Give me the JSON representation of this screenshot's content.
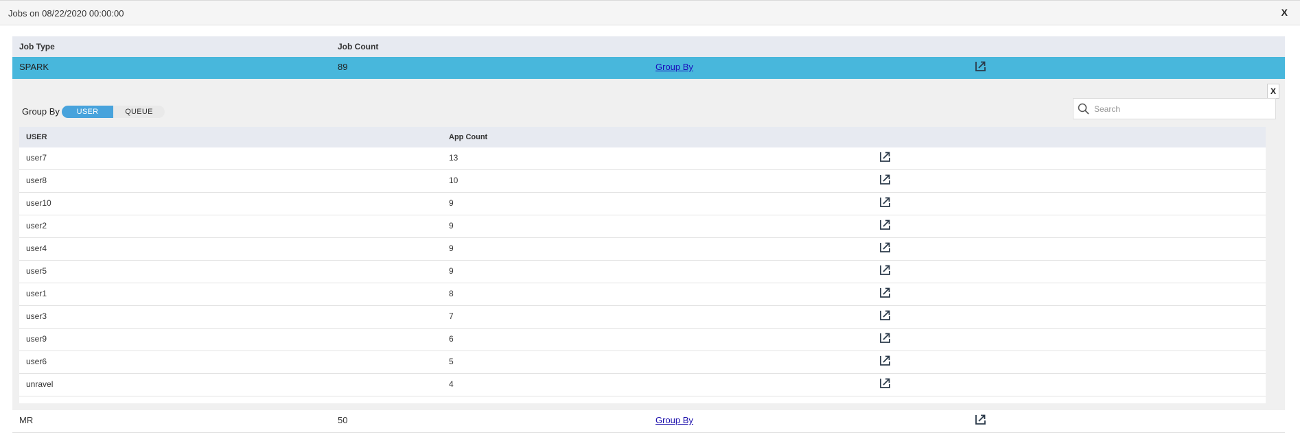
{
  "modal": {
    "title": "Jobs on 08/22/2020 00:00:00",
    "close_label": "X"
  },
  "jobs_table": {
    "headers": {
      "job_type": "Job Type",
      "job_count": "Job Count"
    },
    "rows": [
      {
        "job_type": "SPARK",
        "job_count": "89",
        "group_by_link": "Group By",
        "icon": "external-link-icon"
      },
      {
        "job_type": "MR",
        "job_count": "50",
        "group_by_link": "Group By",
        "icon": "external-link-icon"
      }
    ]
  },
  "group_panel": {
    "close_label": "X",
    "group_by_label": "Group By",
    "toggle": {
      "options": [
        "USER",
        "QUEUE"
      ],
      "selected": "USER"
    },
    "search": {
      "placeholder": "Search",
      "value": ""
    },
    "headers": {
      "user": "USER",
      "app_count": "App Count"
    },
    "rows": [
      {
        "user": "user7",
        "app_count": "13"
      },
      {
        "user": "user8",
        "app_count": "10"
      },
      {
        "user": "user10",
        "app_count": "9"
      },
      {
        "user": "user2",
        "app_count": "9"
      },
      {
        "user": "user4",
        "app_count": "9"
      },
      {
        "user": "user5",
        "app_count": "9"
      },
      {
        "user": "user1",
        "app_count": "8"
      },
      {
        "user": "user3",
        "app_count": "7"
      },
      {
        "user": "user9",
        "app_count": "6"
      },
      {
        "user": "user6",
        "app_count": "5"
      },
      {
        "user": "unravel",
        "app_count": "4"
      }
    ]
  },
  "colors": {
    "selected_row": "#48b7dc",
    "toggle_active": "#48a3dc",
    "header_bg": "#e7eaf1",
    "panel_bg": "#f0f0f0"
  }
}
